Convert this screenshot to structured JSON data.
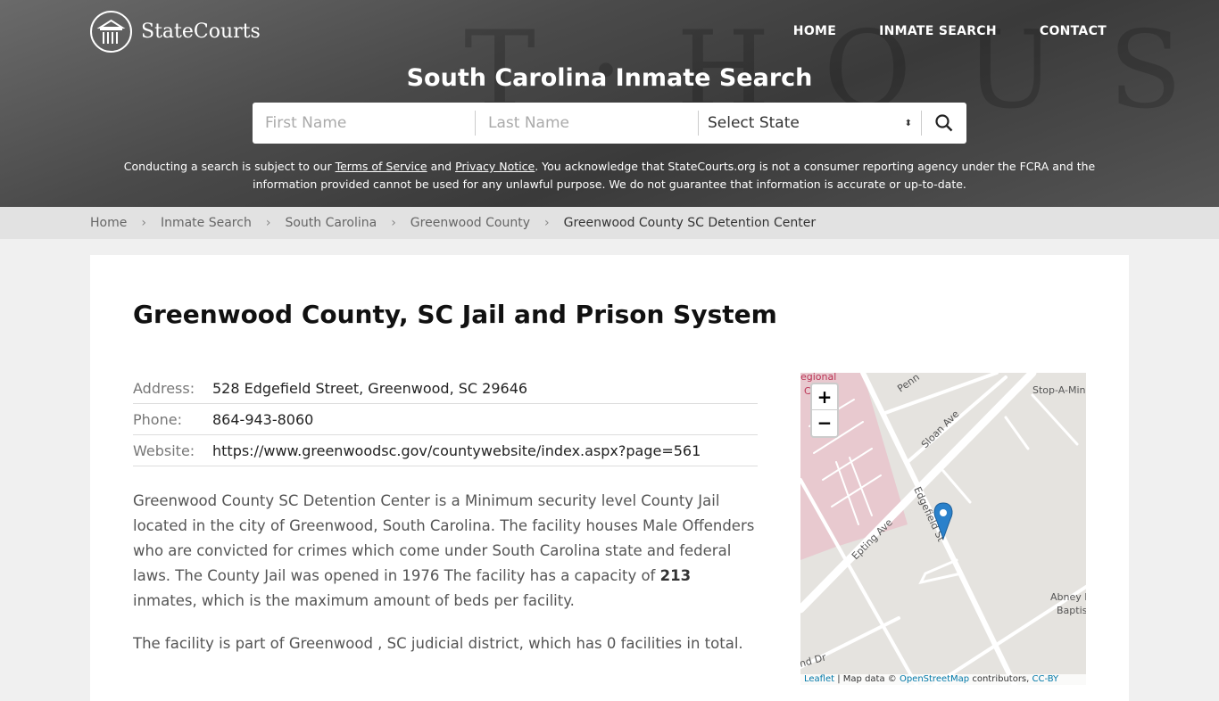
{
  "header": {
    "logo_text": "StateCourts",
    "nav": [
      "HOME",
      "INMATE SEARCH",
      "CONTACT"
    ],
    "title": "South Carolina Inmate Search"
  },
  "search": {
    "first_placeholder": "First Name",
    "last_placeholder": "Last Name",
    "state_select": "Select State"
  },
  "disclaimer": {
    "p1": "Conducting a search is subject to our ",
    "tos": "Terms of Service",
    "and": " and ",
    "privacy": "Privacy Notice",
    "p2": ". You acknowledge that StateCourts.org is not a consumer reporting agency under the FCRA and the information provided cannot be used for any unlawful purpose. We do not guarantee that information is accurate or up-to-date."
  },
  "breadcrumb": [
    "Home",
    "Inmate Search",
    "South Carolina",
    "Greenwood County",
    "Greenwood County SC Detention Center"
  ],
  "main": {
    "title": "Greenwood County, SC Jail and Prison System",
    "info": [
      {
        "label": "Address:",
        "value": "528 Edgefield Street, Greenwood, SC 29646"
      },
      {
        "label": "Phone:",
        "value": "864-943-8060"
      },
      {
        "label": "Website:",
        "value": "https://www.greenwoodsc.gov/countywebsite/index.aspx?page=561"
      }
    ],
    "desc_a": "Greenwood County SC Detention Center is a Minimum security level County Jail located in the city of Greenwood, South Carolina. The facility houses Male Offenders who are convicted for crimes which come under South Carolina state and federal laws. The County Jail was opened in 1976 The facility has a capacity of ",
    "capacity": "213",
    "desc_b": " inmates, which is the maximum amount of beds per facility.",
    "desc2": "The facility is part of Greenwood , SC judicial district, which has 0 facilities in total."
  },
  "map": {
    "zoom_in": "+",
    "zoom_out": "−",
    "labels": [
      "egional",
      "C",
      "Penn",
      "Sloan Ave",
      "Stop-A-Min",
      "Edgefield St",
      "Epting Ave",
      "Abney M",
      "Baptis",
      "nd Dr"
    ],
    "attr_leaflet": "Leaflet",
    "attr_mid": " | Map data © ",
    "attr_osm": "OpenStreetMap",
    "attr_end": " contributors, ",
    "attr_cc": "CC-BY"
  }
}
